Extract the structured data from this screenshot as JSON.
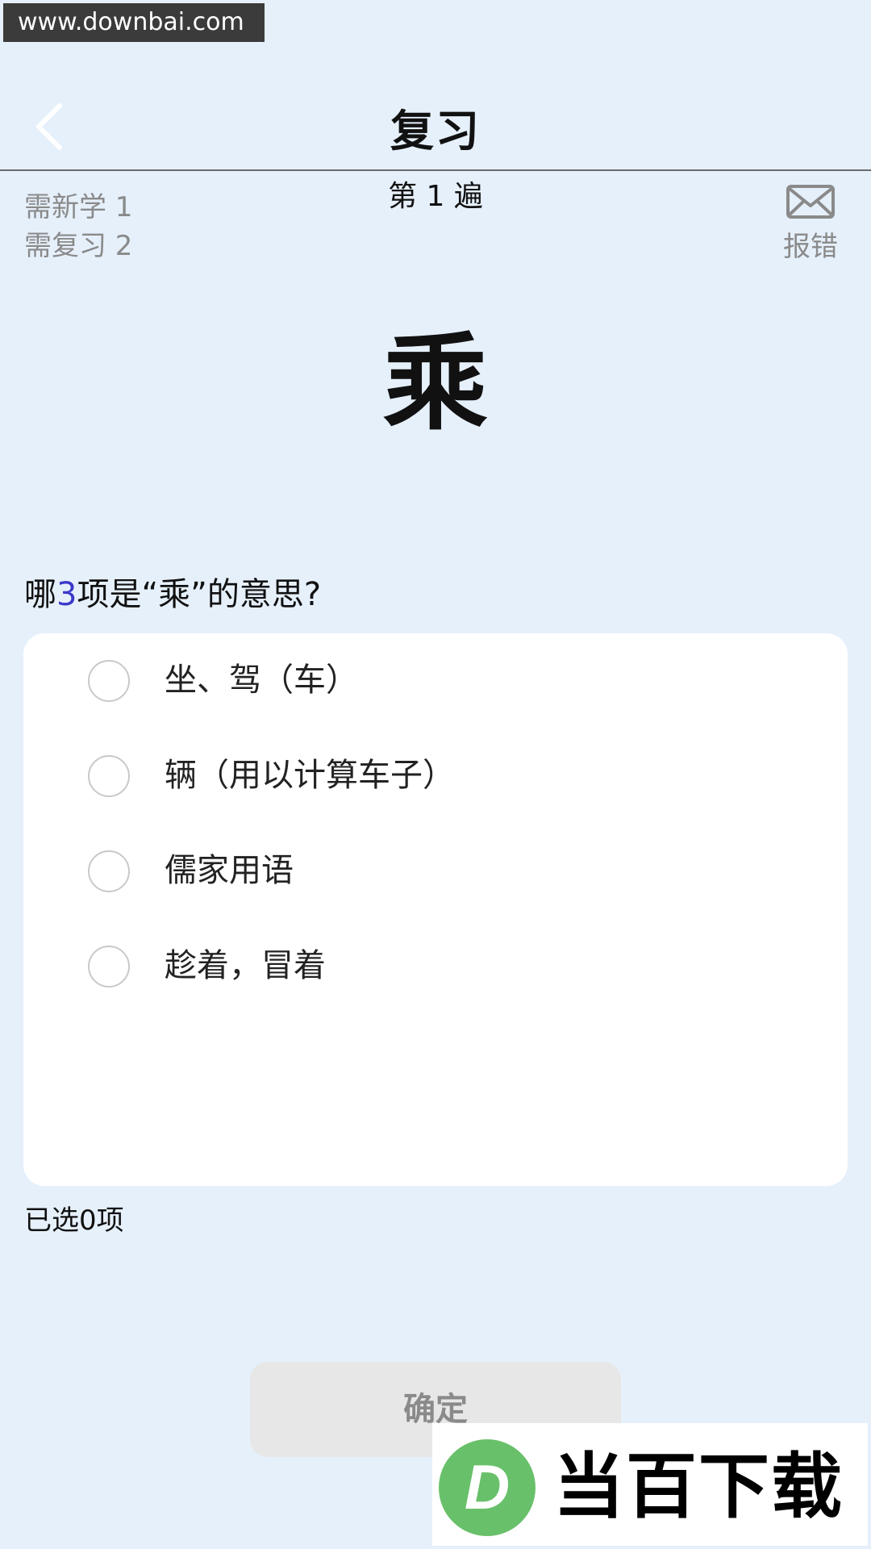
{
  "watermark": {
    "url_text": "www.downbai.com",
    "brand_text": "当百下载",
    "brand_logo_letter": "D",
    "brand_logo_color": "#69c06a"
  },
  "header": {
    "title": "复习"
  },
  "stats": {
    "new_label": "需新学 1",
    "review_label": "需复习 2",
    "round_label": "第 1 遍"
  },
  "report": {
    "label": "报错"
  },
  "card": {
    "character": "乘"
  },
  "question": {
    "prefix": "哪",
    "count": "3",
    "suffix": "项是“乘”的意思?"
  },
  "options": [
    {
      "label": "坐、驾（车）"
    },
    {
      "label": "辆（用以计算车子）"
    },
    {
      "label": "儒家用语"
    },
    {
      "label": "趁着，冒着"
    }
  ],
  "selection": {
    "status": "已选0项"
  },
  "actions": {
    "confirm_label": "确定"
  },
  "colors": {
    "background": "#e6f0fb",
    "accent": "#3b39c9",
    "card": "#ffffff"
  }
}
